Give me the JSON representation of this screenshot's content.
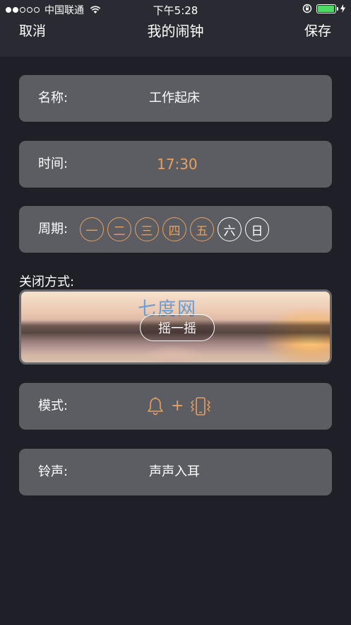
{
  "status_bar": {
    "carrier": "中国联通",
    "time": "下午5:28",
    "battery_level": 0.95,
    "signal_bars_filled": 2,
    "signal_bars_total": 5
  },
  "nav": {
    "cancel": "取消",
    "title": "我的闹钟",
    "save": "保存"
  },
  "name_row": {
    "label": "名称:",
    "value": "工作起床"
  },
  "time_row": {
    "label": "时间:",
    "value": "17:30"
  },
  "weekday_row": {
    "label": "周期:",
    "days": [
      {
        "label": "一",
        "selected": true
      },
      {
        "label": "二",
        "selected": true
      },
      {
        "label": "三",
        "selected": true
      },
      {
        "label": "四",
        "selected": true
      },
      {
        "label": "五",
        "selected": true
      },
      {
        "label": "六",
        "selected": false
      },
      {
        "label": "日",
        "selected": false
      }
    ]
  },
  "close_method": {
    "label": "关闭方式:",
    "button": "摇一摇",
    "watermark": "七度网"
  },
  "mode_row": {
    "label": "模式:",
    "plus": "+",
    "icons": [
      "bell-icon",
      "vibrate-icon"
    ]
  },
  "ringtone_row": {
    "label": "铃声:",
    "value": "声声入耳"
  },
  "colors": {
    "background": "#1f2027",
    "card": "#5b5d63",
    "accent": "#e8a060",
    "battery": "#4cd964"
  }
}
